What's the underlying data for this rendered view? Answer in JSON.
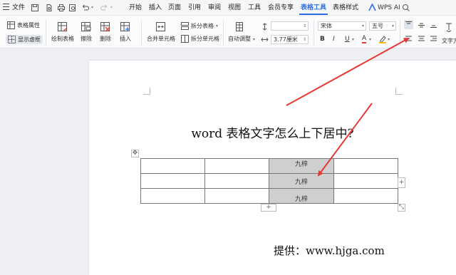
{
  "menubar": {
    "file": "文件",
    "tabs": [
      "开始",
      "插入",
      "页面",
      "引用",
      "审阅",
      "视图",
      "工具",
      "会员专享",
      "表格工具",
      "表格样式"
    ],
    "ai": "WPS AI"
  },
  "ribbon": {
    "table_props": "表格属性",
    "show_grid": "显示虚框",
    "draw_table": "绘制表格",
    "erase": "擦除",
    "delete": "删除",
    "insert": "插入",
    "merge_cells": "合并单元格",
    "split_table": "拆分表格",
    "split_cells": "拆分单元格",
    "auto_fit": "自动调整",
    "width_value": "3.77厘米",
    "font_name": "宋体",
    "font_size": "五号",
    "text_dir": "文字方"
  },
  "document": {
    "title": "word 表格文字怎么上下居中?",
    "cell_text": "九梓",
    "credit": "提供：www.hjga.com"
  },
  "colors": {
    "accent": "#2f6fe4",
    "arrow": "#e53935",
    "selection": "#cfcfcf"
  }
}
